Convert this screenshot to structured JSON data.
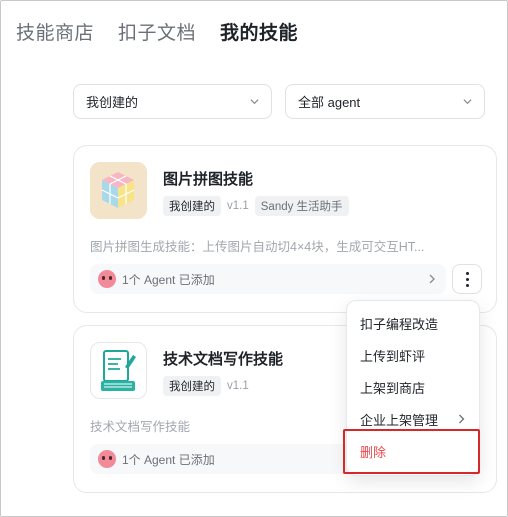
{
  "tabs": [
    {
      "label": "技能商店"
    },
    {
      "label": "扣子文档"
    },
    {
      "label": "我的技能",
      "active": true
    }
  ],
  "filters": {
    "creator": "我创建的",
    "agent": "全部 agent"
  },
  "cards": [
    {
      "title": "图片拼图技能",
      "tag": "我创建的",
      "version": "v1.1",
      "category": "Sandy 生活助手",
      "description": "图片拼图生成技能：上传图片自动切4×4块，生成可交互HT...",
      "agent_status": "1个 Agent 已添加",
      "icon": "jigsaw-cube-icon"
    },
    {
      "title": "技术文档写作技能",
      "tag": "我创建的",
      "version": "v1.1",
      "description": "技术文档写作技能",
      "agent_status": "1个 Agent 已添加",
      "icon": "document-edit-icon"
    }
  ],
  "menu": {
    "items": [
      {
        "label": "扣子编程改造"
      },
      {
        "label": "上传到虾评"
      },
      {
        "label": "上架到商店"
      },
      {
        "label": "企业上架管理",
        "has_submenu": true
      },
      {
        "label": "删除",
        "danger": true
      }
    ]
  },
  "colors": {
    "danger": "#e5484d",
    "highlight_border": "#d62828",
    "avatar": "#f28a9a"
  }
}
